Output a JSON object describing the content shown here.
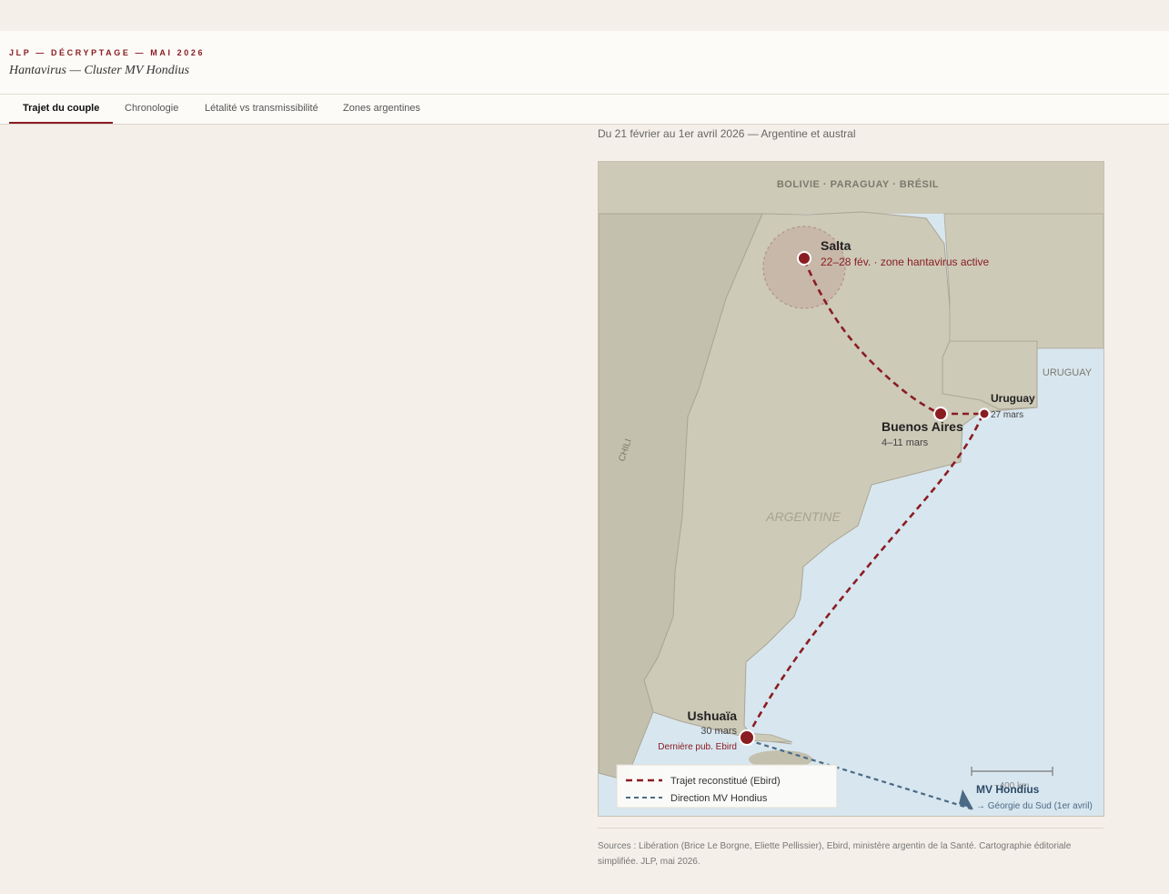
{
  "header": {
    "kicker": "JLP — DÉCRYPTAGE — MAI 2026",
    "subtitle": "Hantavirus — Cluster MV Hondius"
  },
  "tabs": [
    {
      "label": "Trajet du couple",
      "active": true
    },
    {
      "label": "Chronologie",
      "active": false
    },
    {
      "label": "Létalité vs transmissibilité",
      "active": false
    },
    {
      "label": "Zones argentines",
      "active": false
    }
  ],
  "map": {
    "caption": "Du 21 février au 1er avril 2026 — Argentine et austral",
    "regions": {
      "north": "BOLIVIE · PARAGUAY · BRÉSIL",
      "chile": "CHILI",
      "argentina": "ARGENTINE",
      "uruguay": "URUGUAY"
    },
    "places": {
      "salta": {
        "name": "Salta",
        "note": "22–28 fév. · zone hantavirus active"
      },
      "buenos_aires": {
        "name": "Buenos Aires",
        "dates": "4–11 mars"
      },
      "uruguay": {
        "name": "Uruguay",
        "dates": "27 mars"
      },
      "ushuaia": {
        "name": "Ushuaïa",
        "dates": "30 mars",
        "note": "Dernière pub. Ebird"
      }
    },
    "ship": {
      "name": "MV Hondius",
      "destination": "→ Géorgie du Sud (1er avril)"
    },
    "scale": "~400 km",
    "legend": {
      "route": "Trajet reconstitué (Ebird)",
      "ship": "Direction MV Hondius"
    },
    "colors": {
      "route": "#8a1d22",
      "ship": "#4a6a85",
      "land": "#cdcab8",
      "chile": "#c3c0ae",
      "sea": "#d8e6ef"
    }
  },
  "sources": "Sources : Libération (Brice Le Borgne, Eliette Pellissier), Ebird, ministère argentin de la Santé. Cartographie éditoriale simplifiée. JLP, mai 2026."
}
